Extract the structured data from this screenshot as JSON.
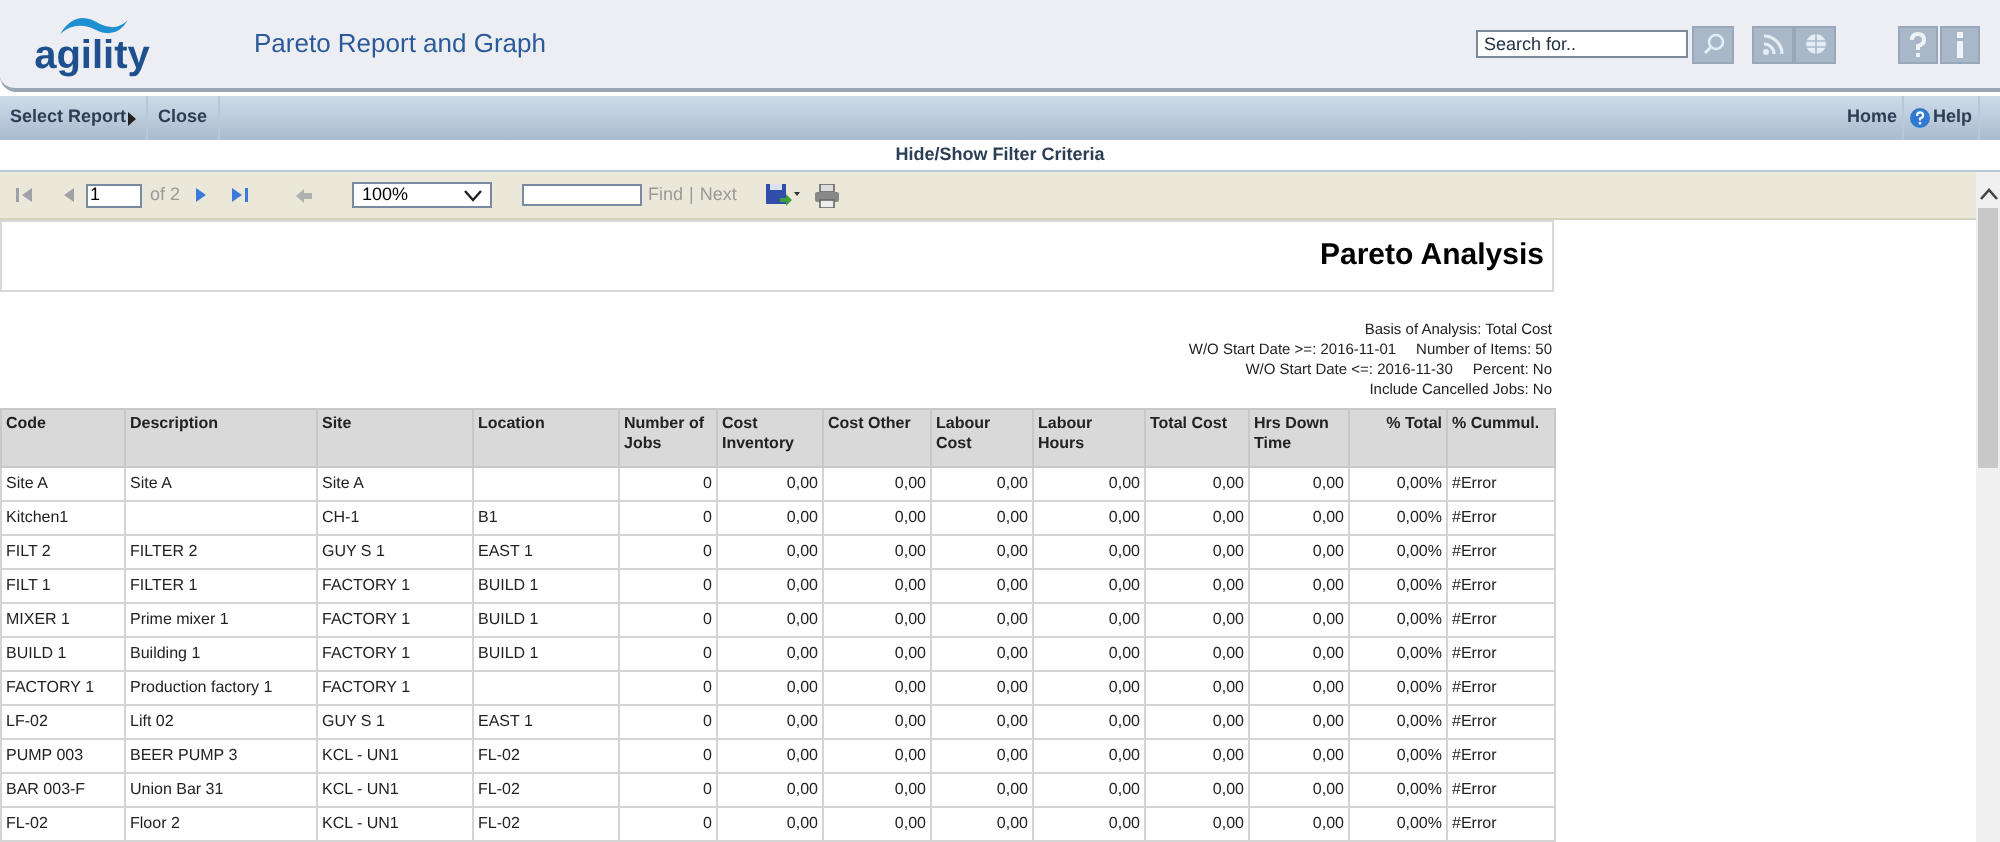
{
  "header": {
    "logo": "agility",
    "title": "Pareto Report and Graph",
    "search": {
      "placeholder": "Search for.."
    }
  },
  "nav": {
    "left": [
      {
        "label": "Select Report",
        "submenu": true
      },
      {
        "label": "Close",
        "submenu": false
      }
    ],
    "right": [
      {
        "label": "Home",
        "kind": "plain"
      },
      {
        "label": "Help",
        "kind": "help"
      }
    ]
  },
  "filter_toggle": "Hide/Show Filter Criteria",
  "toolbar": {
    "page": "1",
    "of": "of 2",
    "zoom": "100%",
    "find": "Find",
    "separator": "|",
    "next": "Next"
  },
  "report": {
    "title": "Pareto Analysis",
    "filters": [
      [
        "Basis of Analysis: Total Cost"
      ],
      [
        "W/O Start Date >=: 2016-11-01",
        "Number of Items: 50"
      ],
      [
        "W/O Start Date <=: 2016-11-30",
        "Percent: No"
      ],
      [
        "Include Cancelled Jobs: No"
      ]
    ],
    "columns": [
      "Code",
      "Description",
      "Site",
      "Location",
      "Number of Jobs",
      "Cost Inventory",
      "Cost Other",
      "Labour Cost",
      "Labour Hours",
      "Total Cost",
      "Hrs Down Time",
      "% Total",
      "% Cummul."
    ],
    "rows": [
      [
        "Site A",
        "Site A",
        "Site A",
        "",
        "0",
        "0,00",
        "0,00",
        "0,00",
        "0,00",
        "0,00",
        "0,00",
        "0,00%",
        "#Error"
      ],
      [
        "Kitchen1",
        "",
        "CH-1",
        "B1",
        "0",
        "0,00",
        "0,00",
        "0,00",
        "0,00",
        "0,00",
        "0,00",
        "0,00%",
        "#Error"
      ],
      [
        "FILT 2",
        "FILTER 2",
        "GUY S 1",
        "EAST 1",
        "0",
        "0,00",
        "0,00",
        "0,00",
        "0,00",
        "0,00",
        "0,00",
        "0,00%",
        "#Error"
      ],
      [
        "FILT 1",
        "FILTER 1",
        "FACTORY 1",
        "BUILD 1",
        "0",
        "0,00",
        "0,00",
        "0,00",
        "0,00",
        "0,00",
        "0,00",
        "0,00%",
        "#Error"
      ],
      [
        "MIXER 1",
        "Prime mixer 1",
        "FACTORY 1",
        "BUILD 1",
        "0",
        "0,00",
        "0,00",
        "0,00",
        "0,00",
        "0,00",
        "0,00",
        "0,00%",
        "#Error"
      ],
      [
        "BUILD 1",
        "Building 1",
        "FACTORY 1",
        "BUILD 1",
        "0",
        "0,00",
        "0,00",
        "0,00",
        "0,00",
        "0,00",
        "0,00",
        "0,00%",
        "#Error"
      ],
      [
        "FACTORY 1",
        "Production factory 1",
        "FACTORY 1",
        "",
        "0",
        "0,00",
        "0,00",
        "0,00",
        "0,00",
        "0,00",
        "0,00",
        "0,00%",
        "#Error"
      ],
      [
        "LF-02",
        "Lift 02",
        "GUY S 1",
        "EAST 1",
        "0",
        "0,00",
        "0,00",
        "0,00",
        "0,00",
        "0,00",
        "0,00",
        "0,00%",
        "#Error"
      ],
      [
        "PUMP 003",
        "BEER PUMP 3",
        "KCL - UN1",
        "FL-02",
        "0",
        "0,00",
        "0,00",
        "0,00",
        "0,00",
        "0,00",
        "0,00",
        "0,00%",
        "#Error"
      ],
      [
        "BAR 003-F",
        "Union Bar 31",
        "KCL - UN1",
        "FL-02",
        "0",
        "0,00",
        "0,00",
        "0,00",
        "0,00",
        "0,00",
        "0,00",
        "0,00%",
        "#Error"
      ],
      [
        "FL-02",
        "Floor 2",
        "KCL - UN1",
        "FL-02",
        "0",
        "0,00",
        "0,00",
        "0,00",
        "0,00",
        "0,00",
        "0,00",
        "0,00%",
        "#Error"
      ]
    ]
  }
}
